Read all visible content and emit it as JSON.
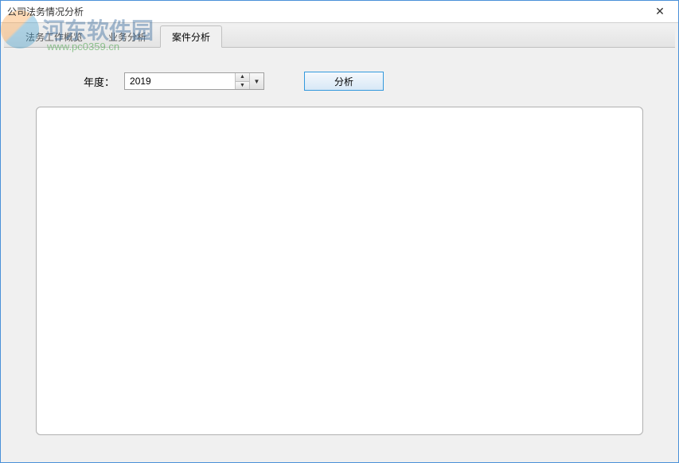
{
  "window": {
    "title": "公司法务情况分析"
  },
  "watermark": {
    "brand": "河东软件园",
    "url": "www.pc0359.cn"
  },
  "tabs": {
    "items": [
      {
        "label": "法务工作概览"
      },
      {
        "label": "业务分析"
      },
      {
        "label": "案件分析"
      }
    ]
  },
  "controls": {
    "year_label": "年度：",
    "year_value": "2019",
    "analyze_label": "分析"
  }
}
